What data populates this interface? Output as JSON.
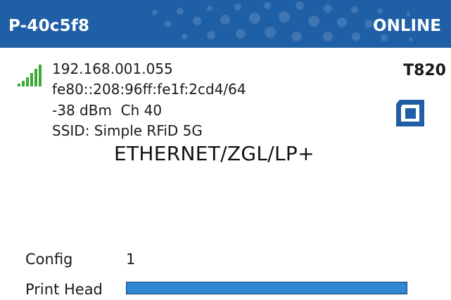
{
  "header": {
    "title": "P-40c5f8",
    "status": "ONLINE",
    "color": "#1f5fa6"
  },
  "network": {
    "signal_icon": "wifi-signal-bars-icon",
    "signal_color": "#3aaa35",
    "ip": "192.168.001.055",
    "ipv6": "fe80::208:96ff:fe1f:2cd4/64",
    "rssi": "-38 dBm  Ch 40",
    "ssid": "SSID: Simple RFiD 5G"
  },
  "protocol": "ETHERNET/ZGL/LP+",
  "printer": {
    "model": "T820",
    "ribbon_icon": "ribbon-cartridge-icon"
  },
  "config": {
    "label": "Config",
    "value": "1"
  },
  "print_head": {
    "label": "Print Head",
    "level_percent": 100,
    "bar_color": "#2f86d1"
  }
}
